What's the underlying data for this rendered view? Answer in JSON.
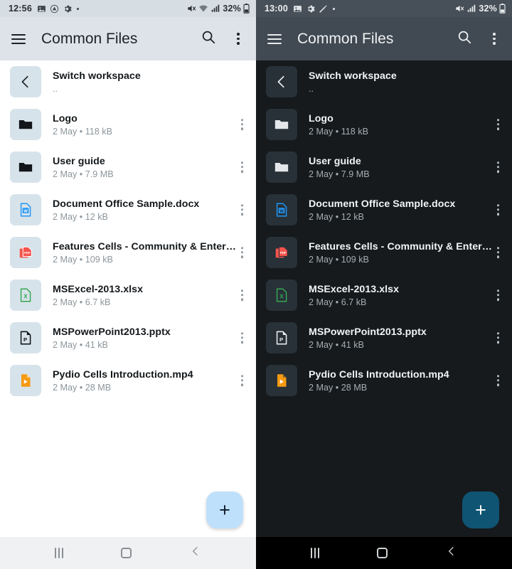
{
  "panels": [
    {
      "theme": "light",
      "statusbar": {
        "time": "12:56",
        "icons": [
          "image-icon",
          "drive-icon",
          "gear-icon",
          "dot-icon"
        ],
        "right_icons": [
          "mute-icon",
          "wifi-icon",
          "signal-icon"
        ],
        "battery": "32%"
      },
      "appbar": {
        "menu_icon": "hamburger-icon",
        "title": "Common Files",
        "search_icon": "search-icon",
        "overflow_icon": "kebab-icon"
      },
      "rows": [
        {
          "icon": "back-chevron-icon",
          "name": "Switch workspace",
          "meta": "..",
          "kebab": false
        },
        {
          "icon": "folder-icon",
          "name": "Logo",
          "meta": "2 May • 118 kB",
          "kebab": true
        },
        {
          "icon": "folder-icon",
          "name": "User guide",
          "meta": "2 May • 7.9 MB",
          "kebab": true
        },
        {
          "icon": "word-icon",
          "name": "Document Office Sample.docx",
          "meta": "2 May • 12 kB",
          "kebab": true
        },
        {
          "icon": "pdf-icon",
          "name": "Features Cells - Community & Enterpr…",
          "meta": "2 May • 109 kB",
          "kebab": true
        },
        {
          "icon": "excel-icon",
          "name": "MSExcel-2013.xlsx",
          "meta": "2 May • 6.7 kB",
          "kebab": true
        },
        {
          "icon": "powerpoint-icon",
          "name": "MSPowerPoint2013.pptx",
          "meta": "2 May • 41 kB",
          "kebab": true
        },
        {
          "icon": "video-icon",
          "name": "Pydio Cells Introduction.mp4",
          "meta": "2 May • 28 MB",
          "kebab": true
        }
      ],
      "fab": {
        "label": "+",
        "icon": "plus-icon"
      },
      "navbar": {
        "recent_icon": "recents-icon",
        "home_icon": "home-icon",
        "back_icon": "back-icon"
      }
    },
    {
      "theme": "dark",
      "statusbar": {
        "time": "13:00",
        "icons": [
          "image-icon",
          "gear-icon",
          "magic-wand-icon",
          "dot-icon"
        ],
        "right_icons": [
          "mute-icon",
          "signal-icon"
        ],
        "battery": "32%"
      },
      "appbar": {
        "menu_icon": "hamburger-icon",
        "title": "Common Files",
        "search_icon": "search-icon",
        "overflow_icon": "kebab-icon"
      },
      "rows": [
        {
          "icon": "back-chevron-icon",
          "name": "Switch workspace",
          "meta": "..",
          "kebab": false
        },
        {
          "icon": "folder-icon",
          "name": "Logo",
          "meta": "2 May • 118 kB",
          "kebab": true
        },
        {
          "icon": "folder-icon",
          "name": "User guide",
          "meta": "2 May • 7.9 MB",
          "kebab": true
        },
        {
          "icon": "word-icon",
          "name": "Document Office Sample.docx",
          "meta": "2 May • 12 kB",
          "kebab": true
        },
        {
          "icon": "pdf-icon",
          "name": "Features Cells - Community & Enterpr…",
          "meta": "2 May • 109 kB",
          "kebab": true
        },
        {
          "icon": "excel-icon",
          "name": "MSExcel-2013.xlsx",
          "meta": "2 May • 6.7 kB",
          "kebab": true
        },
        {
          "icon": "powerpoint-icon",
          "name": "MSPowerPoint2013.pptx",
          "meta": "2 May • 41 kB",
          "kebab": true
        },
        {
          "icon": "video-icon",
          "name": "Pydio Cells Introduction.mp4",
          "meta": "2 May • 28 MB",
          "kebab": true
        }
      ],
      "fab": {
        "label": "+",
        "icon": "plus-icon"
      },
      "navbar": {
        "recent_icon": "recents-icon",
        "home_icon": "home-icon",
        "back_icon": "back-icon"
      }
    }
  ],
  "colors": {
    "light_header": "#dde3e8",
    "light_tile": "#d7e3ea",
    "light_fab": "#bfe0fb",
    "dark_header": "#414952",
    "dark_bg": "#161a1c",
    "dark_tile": "#283138",
    "dark_fab": "#0f5473",
    "word_blue": "#2196f3",
    "pdf_red": "#f4544c",
    "excel_green": "#36a852",
    "video_orange": "#f59a11"
  }
}
